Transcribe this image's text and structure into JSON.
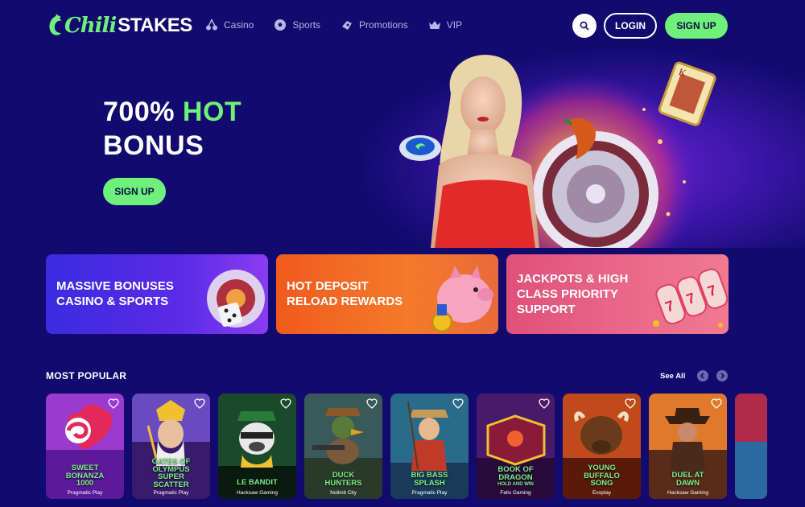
{
  "brand": {
    "name_part1": "Chili",
    "name_part2": "STAKES",
    "accent": "#6ef07a",
    "background": "#120a6e"
  },
  "nav": {
    "items": [
      {
        "label": "Casino",
        "icon": "cherries-icon"
      },
      {
        "label": "Sports",
        "icon": "soccer-ball-icon"
      },
      {
        "label": "Promotions",
        "icon": "gift-icon"
      },
      {
        "label": "VIP",
        "icon": "crown-icon"
      }
    ]
  },
  "header": {
    "search_icon": "search-icon",
    "login_label": "LOGIN",
    "signup_label": "SIGN UP"
  },
  "hero": {
    "title_part1": "700% ",
    "title_hot": "HOT",
    "title_part2": "BONUS",
    "cta_label": "SIGN UP"
  },
  "promos": [
    {
      "line1": "MASSIVE BONUSES",
      "line2": "CASINO & SPORTS",
      "line3": ""
    },
    {
      "line1": "HOT DEPOSIT",
      "line2": "RELOAD REWARDS",
      "line3": ""
    },
    {
      "line1": "JACKPOTS & HIGH",
      "line2": "CLASS PRIORITY",
      "line3": "SUPPORT"
    }
  ],
  "popular": {
    "title": "MOST POPULAR",
    "see_all": "See All",
    "games": [
      {
        "title": [
          "SWEET",
          "BONANZA",
          "1000"
        ],
        "provider": "Pragmatic Play"
      },
      {
        "title": [
          "GATES OF",
          "OLYMPUS",
          "SUPER",
          "SCATTER"
        ],
        "provider": "Pragmatic Play"
      },
      {
        "title": [
          "LE BANDIT"
        ],
        "provider": "Hacksaw Gaming"
      },
      {
        "title": [
          "DUCK",
          "HUNTERS"
        ],
        "provider": "Nolimit City"
      },
      {
        "title": [
          "BIG BASS",
          "SPLASH"
        ],
        "provider": "Pragmatic Play"
      },
      {
        "title": [
          "BOOK OF",
          "DRAGON",
          "HOLD AND WIN"
        ],
        "provider": "Felix Gaming"
      },
      {
        "title": [
          "YOUNG",
          "BUFFALO",
          "SONG"
        ],
        "provider": "Evoplay"
      },
      {
        "title": [
          "DUEL AT",
          "DAWN"
        ],
        "provider": "Hacksaw Gaming"
      }
    ]
  }
}
